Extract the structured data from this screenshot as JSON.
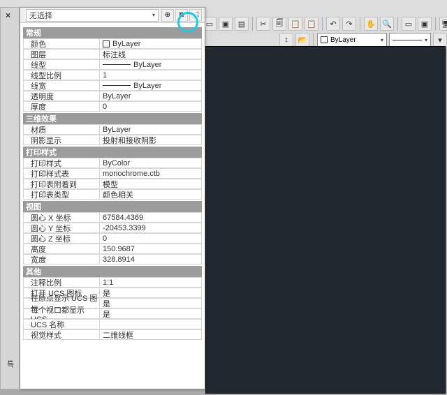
{
  "toolbar": {
    "layer_color": "ByLayer"
  },
  "panel": {
    "selection": "无选择",
    "tab_label": "특"
  },
  "sections": [
    {
      "title": "常规",
      "rows": [
        {
          "label": "颜色",
          "value": "ByLayer",
          "swatch": true
        },
        {
          "label": "图层",
          "value": "标注线"
        },
        {
          "label": "线型",
          "value": "ByLayer",
          "linesample": true
        },
        {
          "label": "线型比例",
          "value": "1"
        },
        {
          "label": "线宽",
          "value": "ByLayer",
          "linesample": true
        },
        {
          "label": "透明度",
          "value": "ByLayer"
        },
        {
          "label": "厚度",
          "value": "0"
        }
      ]
    },
    {
      "title": "三维效果",
      "rows": [
        {
          "label": "材质",
          "value": "ByLayer"
        },
        {
          "label": "阴影显示",
          "value": "投射和接收阴影"
        }
      ]
    },
    {
      "title": "打印样式",
      "rows": [
        {
          "label": "打印样式",
          "value": "ByColor"
        },
        {
          "label": "打印样式表",
          "value": "monochrome.ctb"
        },
        {
          "label": "打印表附着到",
          "value": "模型"
        },
        {
          "label": "打印表类型",
          "value": "颜色相关"
        }
      ]
    },
    {
      "title": "视图",
      "rows": [
        {
          "label": "圆心 X 坐标",
          "value": "67584.4369"
        },
        {
          "label": "圆心 Y 坐标",
          "value": "-20453.3399"
        },
        {
          "label": "圆心 Z 坐标",
          "value": "0"
        },
        {
          "label": "高度",
          "value": "150.9687"
        },
        {
          "label": "宽度",
          "value": "328.8914"
        }
      ]
    },
    {
      "title": "其他",
      "rows": [
        {
          "label": "注释比例",
          "value": "1:1"
        },
        {
          "label": "打开 UCS 图标",
          "value": "是"
        },
        {
          "label": "在原点显示 UCS 图标",
          "value": "是"
        },
        {
          "label": "每个视口都显示 UCS",
          "value": "是"
        },
        {
          "label": "UCS 名称",
          "value": ""
        },
        {
          "label": "视觉样式",
          "value": "二维线框"
        }
      ]
    }
  ]
}
